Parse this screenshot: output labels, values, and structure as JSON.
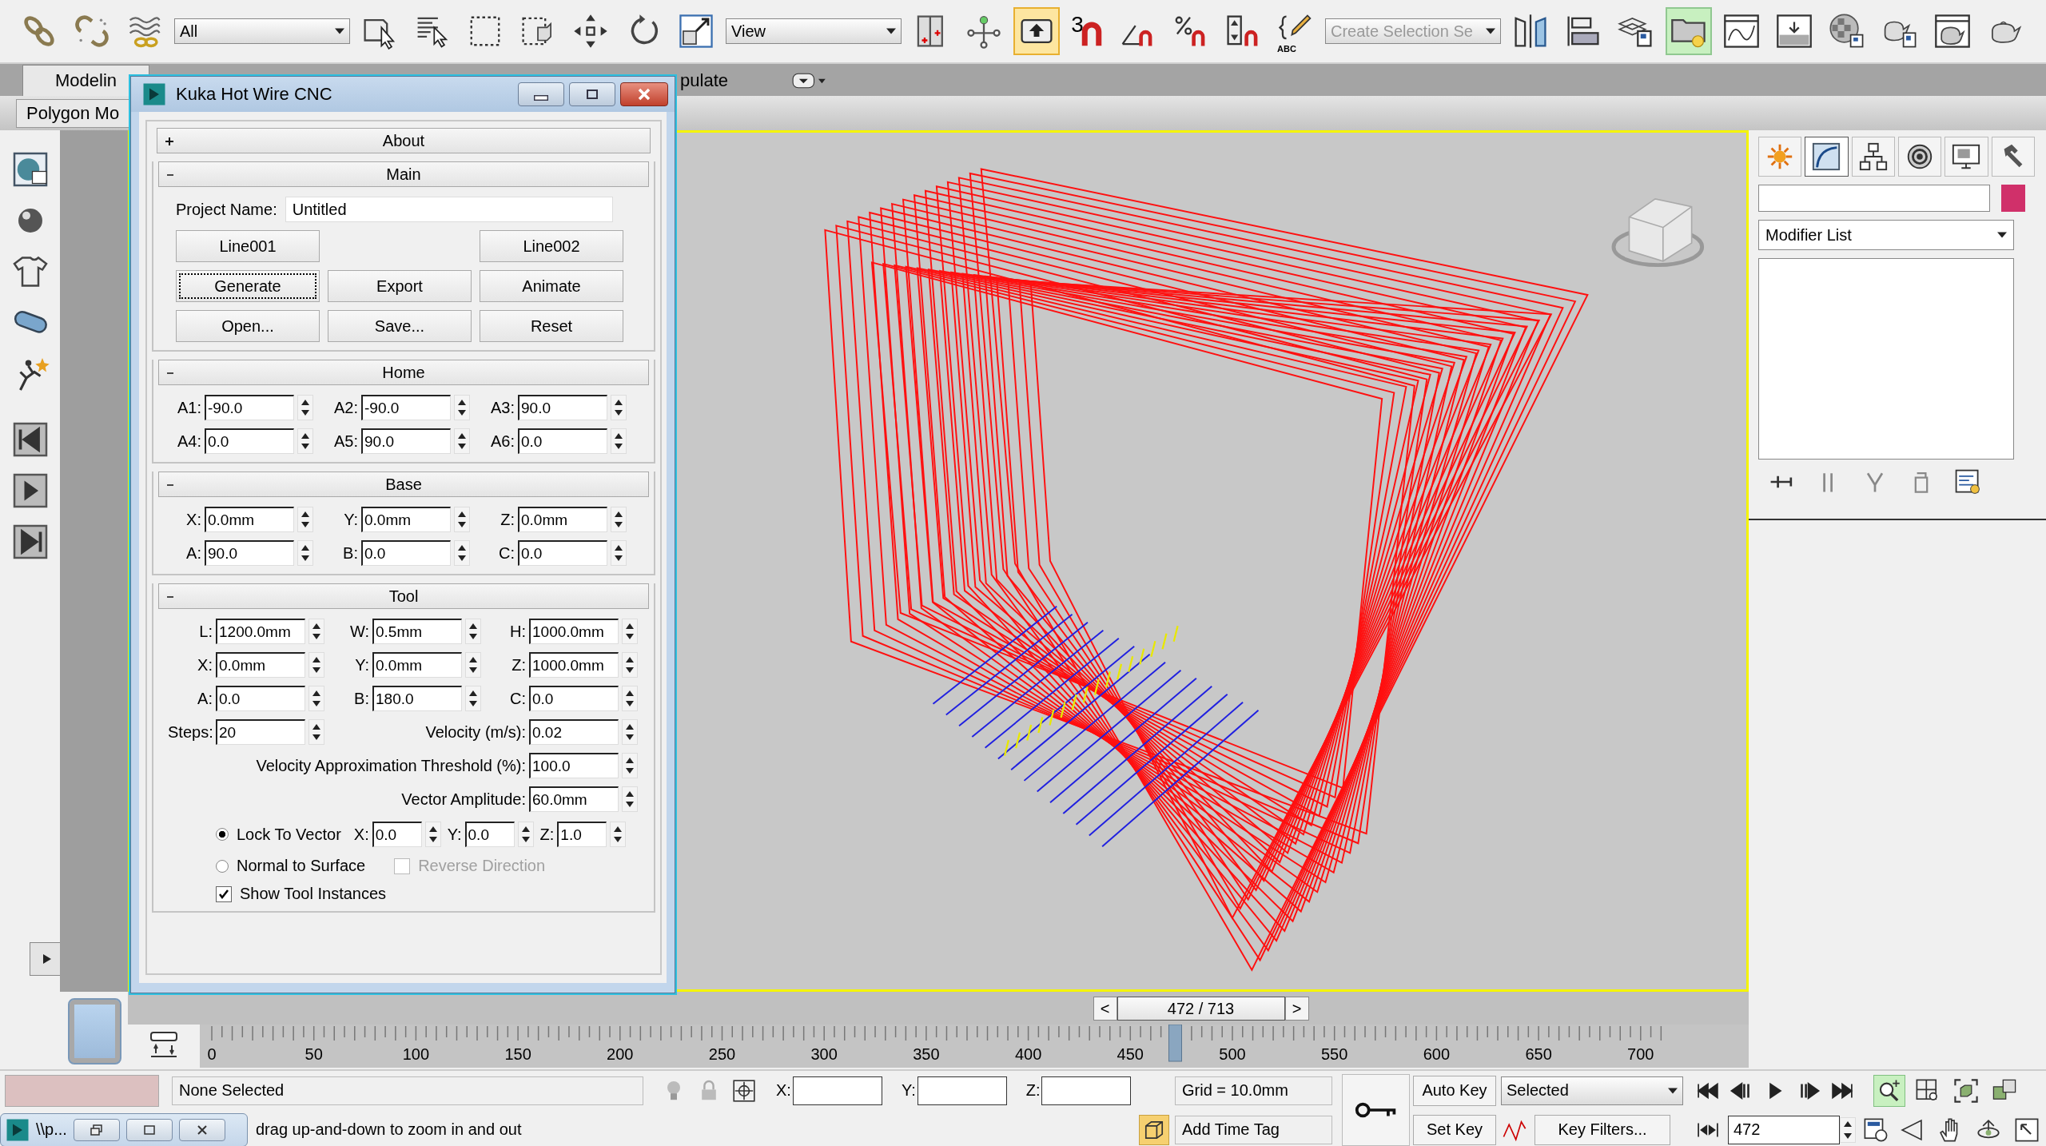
{
  "toolbar": [
    {
      "kind": "button",
      "selected": false
    },
    {
      "kind": "button",
      "selected": false
    },
    {
      "kind": "button",
      "selected": false
    },
    {
      "kind": "dropdown",
      "value": "All"
    },
    {
      "kind": "button",
      "selected": false
    },
    {
      "kind": "button",
      "selected": false
    },
    {
      "kind": "button",
      "selected": false
    },
    {
      "kind": "button",
      "selected": false
    },
    {
      "kind": "button",
      "selected": false
    },
    {
      "kind": "button",
      "selected": false
    },
    {
      "kind": "button",
      "selected": false
    },
    {
      "kind": "dropdown",
      "value": "View"
    },
    {
      "kind": "button",
      "selected": false
    },
    {
      "kind": "button",
      "selected": false
    },
    {
      "kind": "button",
      "selected": true
    },
    {
      "kind": "button",
      "caption": "3",
      "selected": false
    },
    {
      "kind": "button",
      "selected": false
    },
    {
      "kind": "button",
      "selected": false
    },
    {
      "kind": "button",
      "selected": false
    },
    {
      "kind": "button",
      "caption": "ABC",
      "selected": false
    },
    {
      "kind": "dropdown",
      "placeholder": "Create Selection Se"
    },
    {
      "kind": "button",
      "selected": false
    },
    {
      "kind": "button",
      "selected": false
    },
    {
      "kind": "button",
      "selected": false
    },
    {
      "kind": "button",
      "selected": true
    },
    {
      "kind": "button",
      "selected": false
    },
    {
      "kind": "button",
      "selected": false
    },
    {
      "kind": "button",
      "selected": false
    },
    {
      "kind": "button",
      "selected": false
    },
    {
      "kind": "button",
      "selected": false
    },
    {
      "kind": "button",
      "selected": false
    }
  ],
  "ribbon": {
    "tabs": [
      {
        "label": "Modelin",
        "selected": true
      },
      {
        "label": "pulate",
        "selected": false
      }
    ],
    "panel_label": "Polygon Mo"
  },
  "dialog": {
    "title": "Kuka Hot Wire CNC",
    "about": {
      "title": "About",
      "expanded": false
    },
    "main": {
      "title": "Main",
      "expanded": true,
      "project_label": "Project Name:",
      "project_value": "Untitled",
      "button_rows": [
        [
          {
            "kind": "button",
            "label": "Line001",
            "focused": false
          },
          {
            "kind": "spacer"
          },
          {
            "kind": "button",
            "label": "Line002",
            "focused": false
          }
        ],
        [
          {
            "kind": "button",
            "label": "Generate",
            "focused": true
          },
          {
            "kind": "button",
            "label": "Export",
            "focused": false
          },
          {
            "kind": "button",
            "label": "Animate",
            "focused": false
          }
        ],
        [
          {
            "kind": "button",
            "label": "Open...",
            "focused": false
          },
          {
            "kind": "button",
            "label": "Save...",
            "focused": false
          },
          {
            "kind": "button",
            "label": "Reset",
            "focused": false
          }
        ]
      ]
    },
    "home": {
      "title": "Home",
      "expanded": true,
      "fields": [
        {
          "label": "A1:",
          "value": "-90.0"
        },
        {
          "label": "A2:",
          "value": "-90.0"
        },
        {
          "label": "A3:",
          "value": "90.0"
        },
        {
          "label": "A4:",
          "value": "0.0"
        },
        {
          "label": "A5:",
          "value": "90.0"
        },
        {
          "label": "A6:",
          "value": "0.0"
        }
      ]
    },
    "base": {
      "title": "Base",
      "expanded": true,
      "fields": [
        {
          "label": "X:",
          "value": "0.0mm"
        },
        {
          "label": "Y:",
          "value": "0.0mm"
        },
        {
          "label": "Z:",
          "value": "0.0mm"
        },
        {
          "label": "A:",
          "value": "90.0"
        },
        {
          "label": "B:",
          "value": "0.0"
        },
        {
          "label": "C:",
          "value": "0.0"
        }
      ]
    },
    "tool": {
      "title": "Tool",
      "expanded": true,
      "fields": [
        {
          "label": "L:",
          "value": "1200.0mm"
        },
        {
          "label": "W:",
          "value": "0.5mm"
        },
        {
          "label": "H:",
          "value": "1000.0mm"
        },
        {
          "label": "X:",
          "value": "0.0mm"
        },
        {
          "label": "Y:",
          "value": "0.0mm"
        },
        {
          "label": "Z:",
          "value": "1000.0mm"
        },
        {
          "label": "A:",
          "value": "0.0"
        },
        {
          "label": "B:",
          "value": "180.0"
        },
        {
          "label": "C:",
          "value": "0.0"
        }
      ],
      "steps": {
        "label": "Steps:",
        "value": "20"
      },
      "velocity": {
        "label": "Velocity (m/s):",
        "value": "0.02"
      },
      "threshold": {
        "label": "Velocity Approximation Threshold (%):",
        "value": "100.0"
      },
      "amplitude": {
        "label": "Vector Amplitude:",
        "value": "60.0mm"
      },
      "orientation": [
        {
          "label": "Lock To Vector",
          "selected": true,
          "vector": [
            {
              "label": "X:",
              "value": "0.0"
            },
            {
              "label": "Y:",
              "value": "0.0"
            },
            {
              "label": "Z:",
              "value": "1.0"
            }
          ]
        },
        {
          "label": "Normal to Surface",
          "selected": false
        }
      ],
      "reverse": {
        "label": "Reverse Direction",
        "checked": false,
        "disabled": true
      },
      "show_instances": {
        "label": "Show Tool Instances",
        "checked": true,
        "disabled": false
      }
    }
  },
  "command_panel": {
    "tabs": [
      {
        "selected": false
      },
      {
        "selected": true
      },
      {
        "selected": false
      },
      {
        "selected": false
      },
      {
        "selected": false
      },
      {
        "selected": false
      }
    ],
    "color": "#d0306a",
    "modifier_list": "Modifier List"
  },
  "time_slider": {
    "label": "472 / 713",
    "prev": "<",
    "next": ">",
    "level": 0.662
  },
  "ruler": {
    "labels": [
      "0",
      "50",
      "100",
      "150",
      "200",
      "250",
      "300",
      "350",
      "400",
      "450",
      "500",
      "550",
      "600",
      "650",
      "700"
    ]
  },
  "status": {
    "taskbar_title": "\\\\p...",
    "selection": "None Selected",
    "prompt": "drag up-and-down to zoom in and out",
    "x_label": "X:",
    "y_label": "Y:",
    "z_label": "Z:",
    "grid": "Grid = 10.0mm",
    "time_tag": "Add Time Tag",
    "auto_key": {
      "label": "Auto Key",
      "on": false
    },
    "set_key": "Set Key",
    "key_mode": "Selected",
    "key_filters": "Key Filters...",
    "frame": "472"
  },
  "viewport_nav": [
    {
      "selected": true
    },
    {
      "selected": false
    },
    {
      "selected": false
    },
    {
      "selected": false
    },
    {
      "selected": false
    },
    {
      "selected": false
    },
    {
      "selected": false
    },
    {
      "selected": false
    }
  ]
}
